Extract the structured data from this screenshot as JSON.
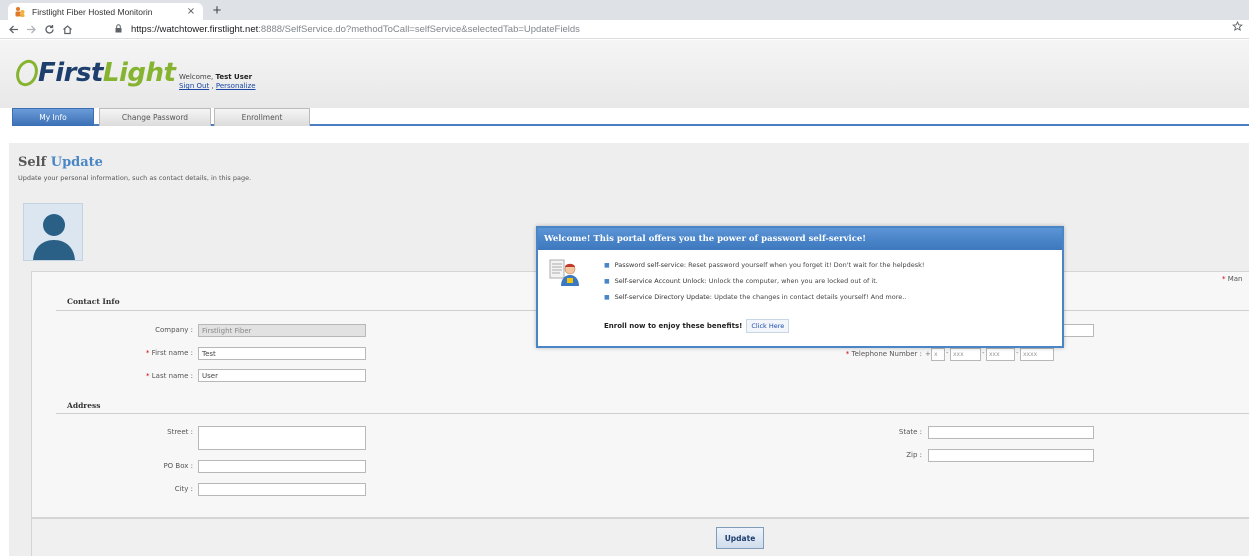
{
  "browser": {
    "tab_title": "Firstlight Fiber Hosted Monitorin",
    "tab_close": "×",
    "new_tab": "+",
    "url_host": "https://watchtower.firstlight.net",
    "url_rest": ":8888/SelfService.do?methodToCall=selfService&selectedTab=UpdateFields"
  },
  "header": {
    "logo_first": "First",
    "logo_light": "Light",
    "welcome_prefix": "Welcome, ",
    "user_name": "Test User",
    "sign_out": "Sign Out",
    "separator": " , ",
    "personalize": "Personalize"
  },
  "tabs": [
    {
      "label": "My Info",
      "active": true
    },
    {
      "label": "Change Password",
      "active": false
    },
    {
      "label": "Enrollment",
      "active": false
    }
  ],
  "page": {
    "title_prefix": "Self",
    "title_accent": "Update",
    "subtitle": "Update your personal information, such as contact details, in this page.",
    "mandatory_marker": "*",
    "mandatory_text": " Man"
  },
  "form": {
    "contact_heading": "Contact Info",
    "address_heading": "Address",
    "required_marker": "*",
    "company_label": "Company :",
    "company_value": "Firstlight Fiber",
    "first_name_label": " First name :",
    "first_name_value": "Test",
    "last_name_label": " Last name :",
    "last_name_value": "User",
    "telephone_label": " Telephone Number :",
    "phone_plus": "+",
    "phone_country": "x",
    "phone_area": "xxx",
    "phone_prefix": "xxx",
    "phone_line": "xxxx",
    "phone_dash": "-",
    "street_label": "Street :",
    "pobox_label": "PO Box :",
    "city_label": "City :",
    "state_label": "State :",
    "zip_label": "Zip :",
    "update_button": "Update"
  },
  "modal": {
    "title": "Welcome! This portal offers you the power of password self-service!",
    "bullet": "■",
    "items": [
      {
        "strong": "Password self-service: ",
        "text": "Reset password yourself when you forget it! Don't wait for the helpdesk!"
      },
      {
        "strong": "Self-service Account Unlock: ",
        "text": "Unlock the computer, when you are locked out of it."
      },
      {
        "strong": "Self-service Directory Update: ",
        "text": "Update the changes in contact details yourself! And more.."
      }
    ],
    "enroll_text": "Enroll now to enjoy these benefits!",
    "click_here": "Click Here"
  },
  "colors": {
    "brand_navy": "#1e3f6e",
    "brand_green": "#86b431",
    "accent_blue": "#4a86c5",
    "required_red": "#cc0000"
  },
  "icons": [
    "favicon-icon",
    "back-icon",
    "forward-icon",
    "reload-icon",
    "home-icon",
    "lock-icon",
    "star-icon",
    "user-avatar-icon",
    "self-service-icon"
  ]
}
